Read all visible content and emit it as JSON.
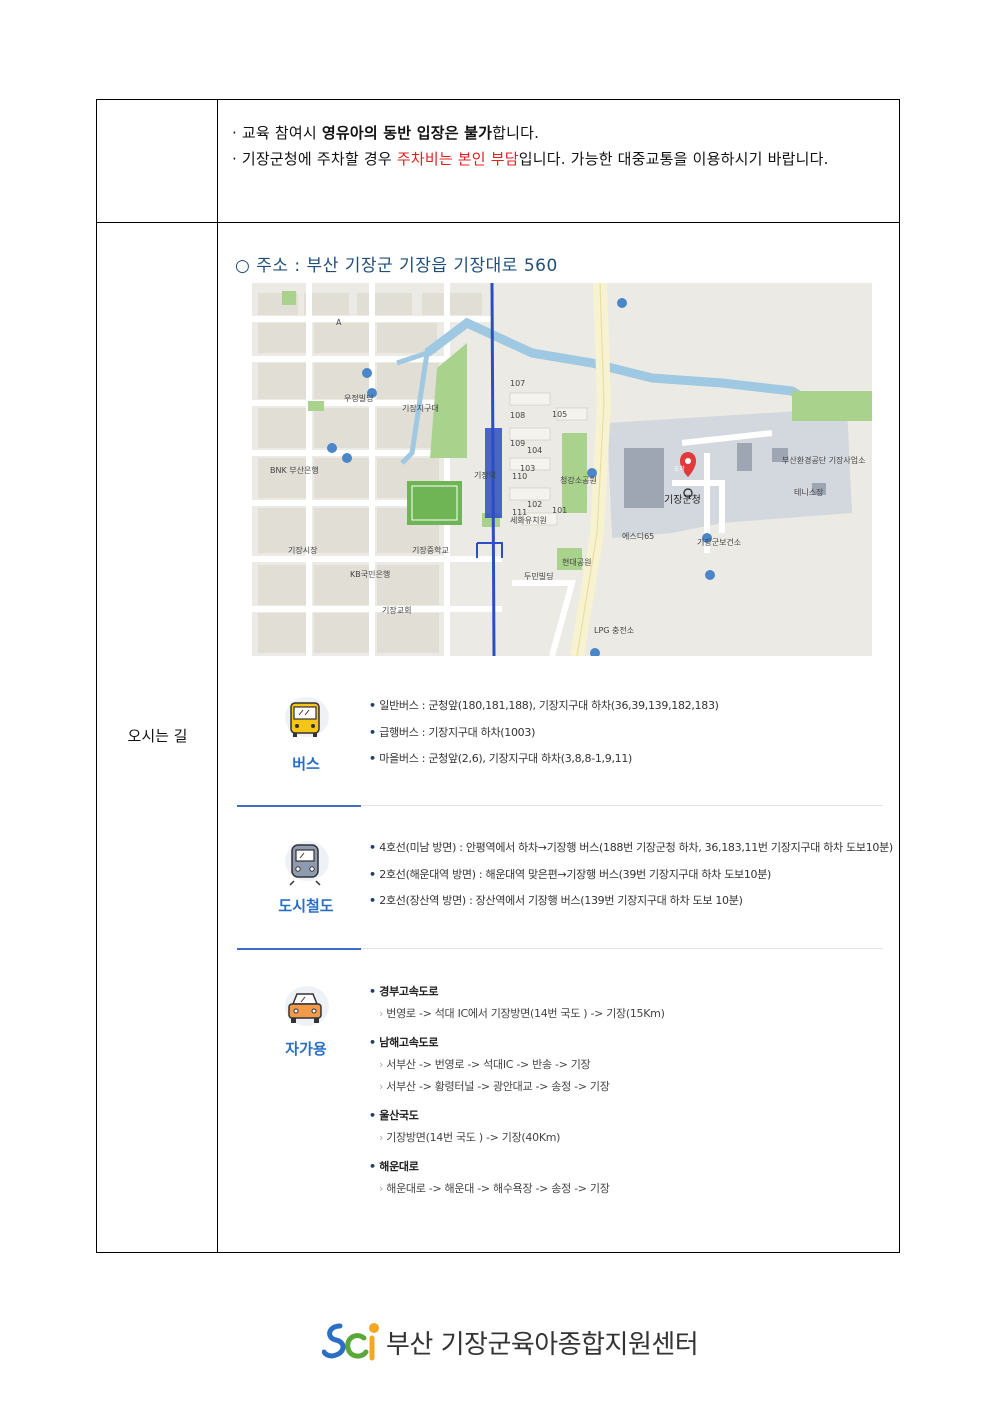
{
  "notice": {
    "line1_prefix": "· 교육 참여시 ",
    "line1_bold": "영유아의 동반 입장은 불가",
    "line1_suffix": "합니다.",
    "line2_prefix": "· 기장군청에 주차할 경우 ",
    "line2_red": "주차비는 본인 부담",
    "line2_suffix": "입니다. 가능한 대중교통을 이용하시기 바랍니다."
  },
  "row_label": "오시는 길",
  "address": "○ 주소 : 부산 기장군 기장읍 기장대로 560",
  "map": {
    "labels": [
      "기장군청",
      "기장시장",
      "기장역",
      "기장중학교",
      "KB국민은행",
      "BNK 부산은행",
      "세화유치원",
      "기장교회",
      "현대공원",
      "두민빌딩",
      "에스디65",
      "기장군보건소",
      "부산환경공단 기장사업소",
      "테니스장",
      "LPG 충전소",
      "우정빌딩",
      "기장지구대",
      "청강소공원",
      "도착",
      "102",
      "103",
      "104",
      "105",
      "107",
      "108",
      "109",
      "110",
      "111",
      "101",
      "A"
    ],
    "colors": {
      "road": "#f7f2cf",
      "park": "#a9d28d",
      "water": "#9fc8e3",
      "rail": "#2d4ec1",
      "marker": "#e03a3a"
    }
  },
  "bus": {
    "title": "버스",
    "items": [
      "일반버스 : 군청앞(180,181,188), 기장지구대 하차(36,39,139,182,183)",
      "급행버스 : 기장지구대 하차(1003)",
      "마을버스 : 군청앞(2,6), 기장지구대 하차(3,8,8-1,9,11)"
    ]
  },
  "subway": {
    "title": "도시철도",
    "items": [
      "4호선(미남 방면) : 안평역에서 하차→기장행 버스(188번 기장군청 하차, 36,183,11번 기장지구대 하차 도보10분)",
      "2호선(해운대역 방면) : 해운대역 맞은편→기장행 버스(39번 기장지구대 하차 도보10분)",
      "2호선(장산역 방면) : 장산역에서 기장행 버스(139번 기장지구대 하차 도보 10분)"
    ]
  },
  "car": {
    "title": "자가용",
    "routes": [
      {
        "name": "경부고속도로",
        "subs": [
          "번영로 -> 석대 IC에서 기장방면(14번 국도 ) -> 기장(15Km)"
        ]
      },
      {
        "name": "남해고속도로",
        "subs": [
          "서부산 -> 번영로 -> 석대IC -> 반송 -> 기장",
          "서부산 -> 황령터널 -> 광안대교 -> 송정 -> 기장"
        ]
      },
      {
        "name": "울산국도",
        "subs": [
          "기장방면(14번 국도 ) -> 기장(40Km)"
        ]
      },
      {
        "name": "해운대로",
        "subs": [
          "해운대로 -> 해운대 -> 해수욕장 -> 송정 -> 기장"
        ]
      }
    ]
  },
  "footer": {
    "org": "부산 기장군육아종합지원센터",
    "logo_icon": "sci-logo-icon"
  },
  "colors": {
    "accent_blue": "#2a6fc4",
    "address_blue": "#1f4e79",
    "warning_red": "#e02020"
  }
}
